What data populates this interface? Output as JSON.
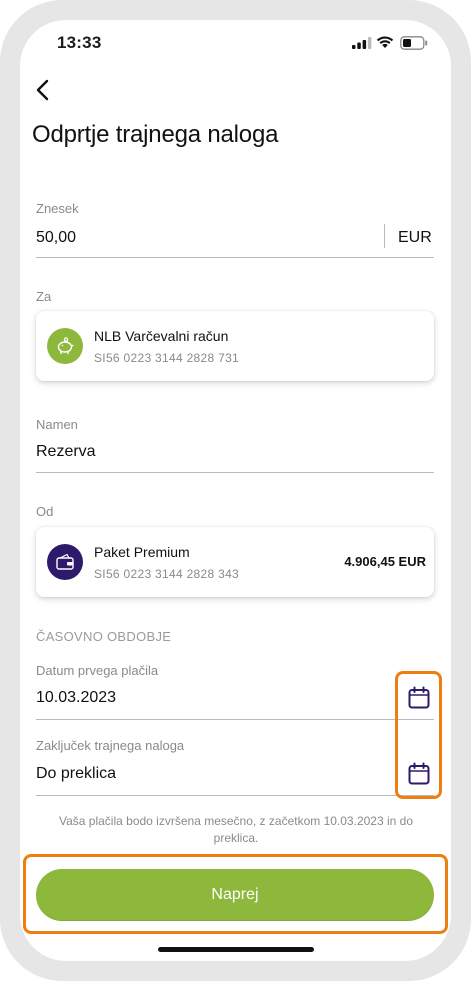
{
  "status_bar": {
    "time": "13:33"
  },
  "header": {
    "title": "Odprtje trajnega naloga"
  },
  "amount": {
    "label": "Znesek",
    "value": "50,00",
    "currency": "EUR"
  },
  "to": {
    "label": "Za",
    "account_name": "NLB Varčevalni račun",
    "iban": "SI56 0223 3144 2828 731",
    "icon": "piggy-bank-icon",
    "icon_color": "#8db83c"
  },
  "purpose": {
    "label": "Namen",
    "value": "Rezerva"
  },
  "from": {
    "label": "Od",
    "account_name": "Paket Premium",
    "iban": "SI56 0223 3144 2828 343",
    "balance": "4.906,45 EUR",
    "icon": "wallet-icon",
    "icon_color": "#2e1a6b"
  },
  "period": {
    "section_title": "ČASOVNO OBDOBJE",
    "first_payment_label": "Datum prvega plačila",
    "first_payment_value": "10.03.2023",
    "end_label": "Zaključek trajnega naloga",
    "end_value": "Do preklica"
  },
  "note": "Vaša plačila bodo izvršena mesečno, z začetkom 10.03.2023 in do preklica.",
  "actions": {
    "next_label": "Naprej"
  },
  "colors": {
    "accent": "#8db83c",
    "highlight": "#ee7d12",
    "icon": "#2e1a6b"
  }
}
